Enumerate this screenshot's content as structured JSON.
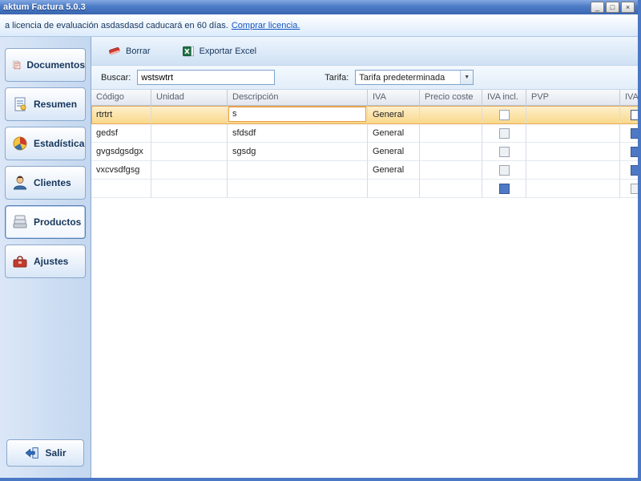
{
  "window": {
    "title": "aktum Factura 5.0.3",
    "minimize": "_",
    "maximize": "□",
    "close": "×"
  },
  "license_bar": {
    "text": "a licencia de evaluación asdasdasd caducará en 60 días.",
    "link": "Comprar licencia."
  },
  "sidebar": {
    "items": [
      {
        "label": "Documentos"
      },
      {
        "label": "Resumen"
      },
      {
        "label": "Estadística"
      },
      {
        "label": "Clientes"
      },
      {
        "label": "Productos"
      },
      {
        "label": "Ajustes"
      }
    ],
    "exit_label": "Salir"
  },
  "toolbar": {
    "delete_label": "Borrar",
    "export_label": "Exportar Excel"
  },
  "filters": {
    "search_label": "Buscar:",
    "search_value": "wstswtrt",
    "tariff_label": "Tarifa:",
    "tariff_value": "Tarifa predeterminada"
  },
  "table": {
    "columns": [
      "Código",
      "Unidad",
      "Descripción",
      "IVA",
      "Precio coste",
      "IVA incl.",
      "PVP",
      "IVA i"
    ],
    "rows": [
      {
        "codigo": "rtrtrt",
        "unidad": "",
        "descripcion": "s",
        "iva": "General",
        "precio_coste": "",
        "iva_incl": false,
        "pvp": "",
        "iva_incl_2": true
      },
      {
        "codigo": "gedsf",
        "unidad": "",
        "descripcion": "sfdsdf",
        "iva": "General",
        "precio_coste": "",
        "iva_incl": false,
        "pvp": "",
        "iva_incl_2": true
      },
      {
        "codigo": "gvgsdgsdgx",
        "unidad": "",
        "descripcion": "sgsdg",
        "iva": "General",
        "precio_coste": "",
        "iva_incl": false,
        "pvp": "",
        "iva_incl_2": true
      },
      {
        "codigo": "vxcvsdfgsg",
        "unidad": "",
        "descripcion": "",
        "iva": "General",
        "precio_coste": "",
        "iva_incl": false,
        "pvp": "",
        "iva_incl_2": true
      },
      {
        "codigo": "",
        "unidad": "",
        "descripcion": "",
        "iva": "",
        "precio_coste": "",
        "iva_incl": true,
        "pvp": "",
        "iva_incl_2": false
      }
    ]
  },
  "colors": {
    "titlebar_blue": "#4c7cc7",
    "selection_orange": "#f9d787",
    "link_blue": "#1556c4",
    "excel_green": "#1e7145",
    "delete_red": "#d23b2f"
  }
}
